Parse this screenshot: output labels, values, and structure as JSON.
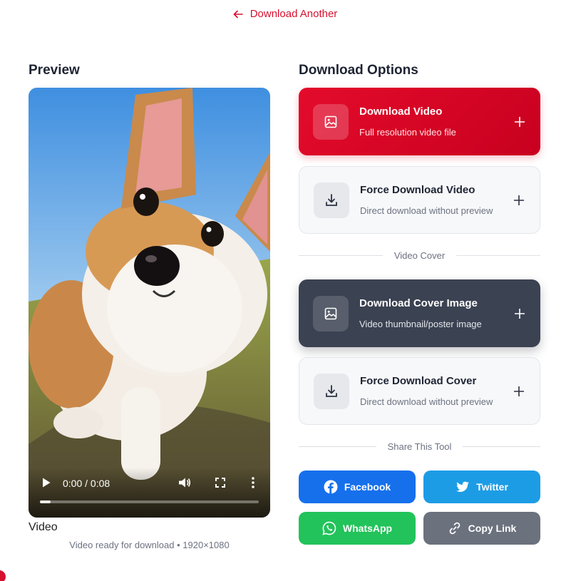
{
  "nav": {
    "back_label": "Download Another"
  },
  "preview": {
    "heading": "Preview",
    "player": {
      "time": "0:00 / 0:08",
      "progress": 0.05
    },
    "label": "Video",
    "status": "Video ready for download • 1920×1080"
  },
  "options": {
    "heading": "Download Options",
    "download_video": {
      "title": "Download Video",
      "subtitle": "Full resolution video file"
    },
    "force_video": {
      "title": "Force Download Video",
      "subtitle": "Direct download without preview"
    },
    "cover_divider": "Video Cover",
    "download_cover": {
      "title": "Download Cover Image",
      "subtitle": "Video thumbnail/poster image"
    },
    "force_cover": {
      "title": "Force Download Cover",
      "subtitle": "Direct download without preview"
    }
  },
  "share": {
    "divider": "Share This Tool",
    "facebook": "Facebook",
    "twitter": "Twitter",
    "whatsapp": "WhatsApp",
    "copy_link": "Copy Link"
  },
  "colors": {
    "accent_red": "#d6102e",
    "dark_card": "#3b4252",
    "facebook": "#1670ec",
    "twitter": "#1d9ce6",
    "whatsapp": "#22c35a",
    "copy_link": "#6b717d"
  },
  "icons": {
    "back": "arrow-left-icon",
    "image": "image-icon",
    "download": "download-icon",
    "plus": "plus-icon",
    "play": "play-icon",
    "volume": "volume-icon",
    "fullscreen": "fullscreen-icon",
    "more": "more-vertical-icon",
    "facebook": "facebook-icon",
    "twitter": "twitter-icon",
    "whatsapp": "whatsapp-icon",
    "link": "link-icon"
  }
}
